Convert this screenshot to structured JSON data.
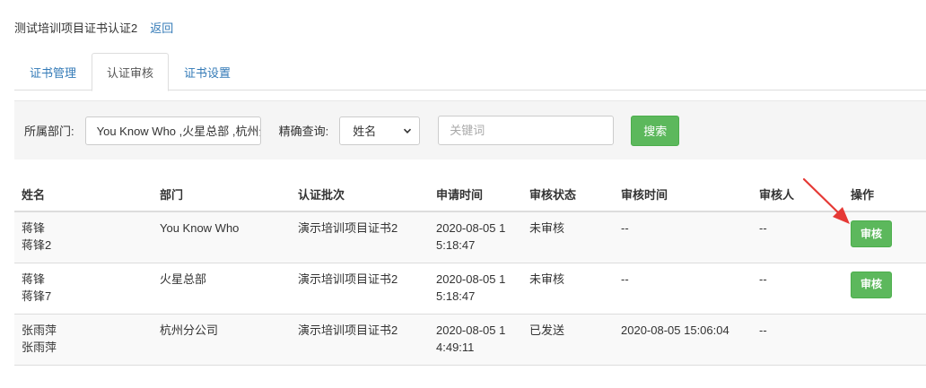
{
  "header": {
    "title": "测试培训项目证书认证2",
    "back_link": "返回"
  },
  "tabs": [
    {
      "label": "证书管理",
      "active": false
    },
    {
      "label": "认证审核",
      "active": true
    },
    {
      "label": "证书设置",
      "active": false
    }
  ],
  "filter": {
    "dept_label": "所属部门:",
    "dept_value": "You Know Who ,火星总部 ,杭州分公司",
    "exact_label": "精确查询:",
    "select_value": "姓名",
    "keyword_placeholder": "关键词",
    "search_button": "搜索"
  },
  "table": {
    "columns": [
      "姓名",
      "部门",
      "认证批次",
      "申请时间",
      "审核状态",
      "审核时间",
      "审核人",
      "操作"
    ],
    "rows": [
      {
        "name_line1": "蒋锋",
        "name_line2": "蒋锋2",
        "dept": "You Know Who",
        "batch": "演示培训项目证书2",
        "apply_line1": "2020-08-05 1",
        "apply_line2": "5:18:47",
        "status": "未审核",
        "audit_time": "--",
        "auditor": "--",
        "action": "审核"
      },
      {
        "name_line1": "蒋锋",
        "name_line2": "蒋锋7",
        "dept": "火星总部",
        "batch": "演示培训项目证书2",
        "apply_line1": "2020-08-05 1",
        "apply_line2": "5:18:47",
        "status": "未审核",
        "audit_time": "--",
        "auditor": "--",
        "action": "审核"
      },
      {
        "name_line1": "张雨萍",
        "name_line2": "张雨萍",
        "dept": "杭州分公司",
        "batch": "演示培训项目证书2",
        "apply_line1": "2020-08-05 1",
        "apply_line2": "4:49:11",
        "status": "已发送",
        "audit_time": "2020-08-05 15:06:04",
        "auditor": "--",
        "action": ""
      }
    ]
  },
  "colors": {
    "link": "#337ab7",
    "success": "#5cb85c",
    "arrow": "#e53935"
  },
  "icons": {
    "select_caret": "chevron-down-icon",
    "annotation": "red-arrow-icon"
  }
}
